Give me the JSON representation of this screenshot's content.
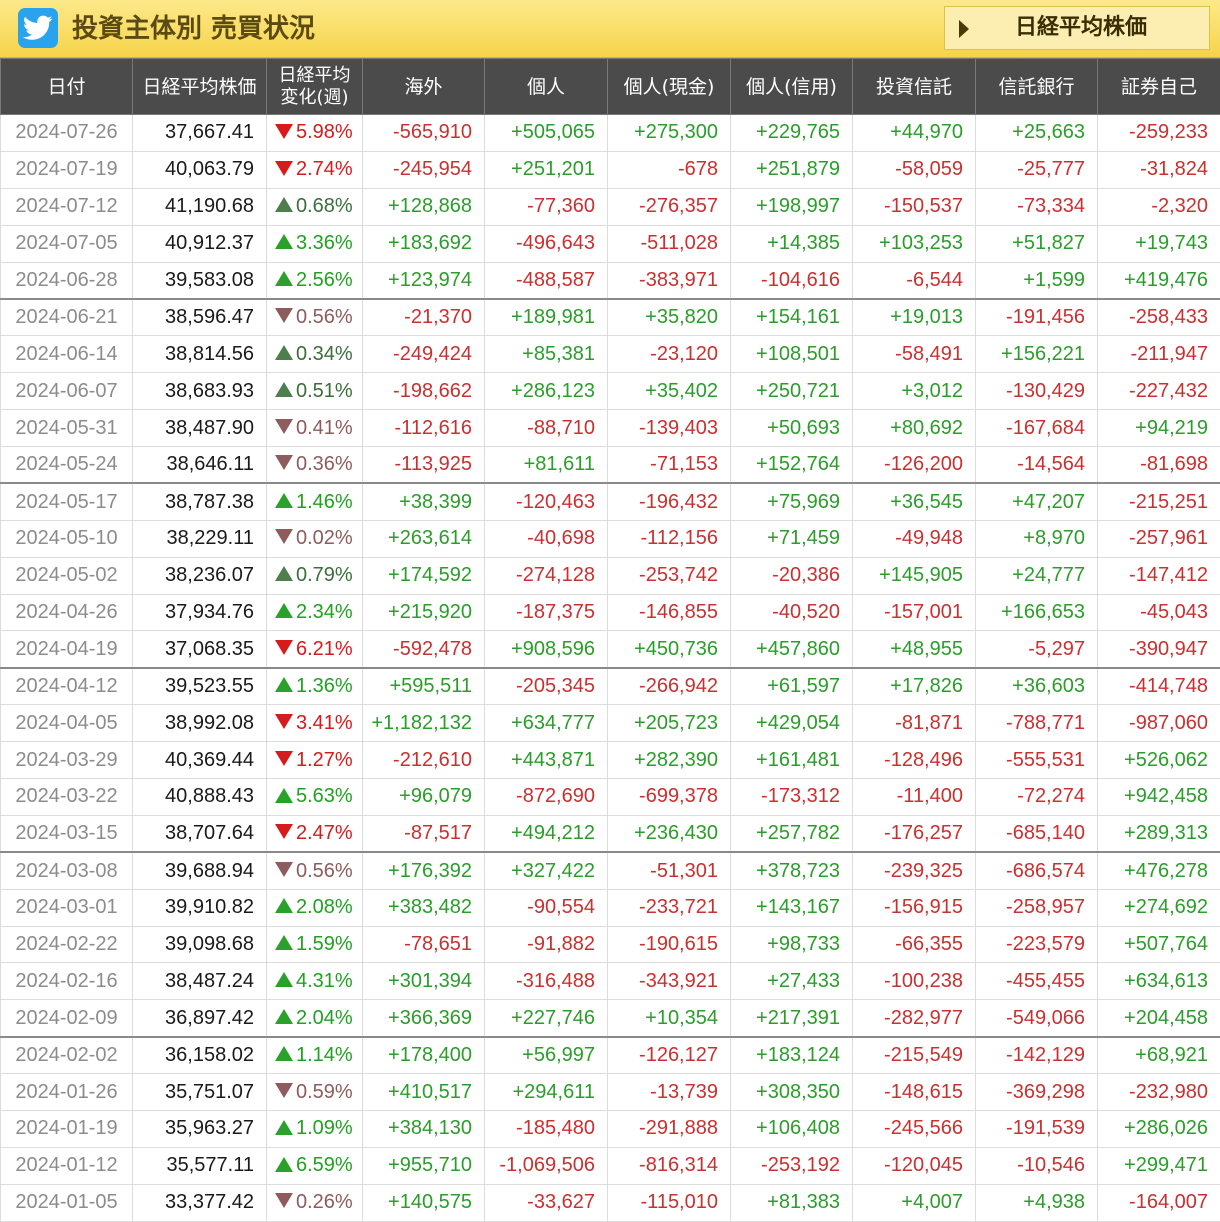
{
  "header": {
    "title": "投資主体別 売買状況",
    "nikkei_button_label": "日経平均株価",
    "twitter_icon": "twitter-bird-icon"
  },
  "colors": {
    "header_bg": "#f6d44a",
    "table_header_bg": "#4b4b4b",
    "positive": "#2a9d2a",
    "negative": "#c93030",
    "twitter": "#2aa3ef"
  },
  "columns": [
    "日付",
    "日経平均株価",
    "日経平均 変化(週)",
    "海外",
    "個人",
    "個人(現金)",
    "個人(信用)",
    "投資信託",
    "信託銀行",
    "証券自己"
  ],
  "rows": [
    {
      "date": "2024-07-26",
      "nikkei": "37,667.41",
      "change": "5.98%",
      "dir": "down",
      "big": true,
      "values": [
        "-565,910",
        "+505,065",
        "+275,300",
        "+229,765",
        "+44,970",
        "+25,663",
        "-259,233"
      ]
    },
    {
      "date": "2024-07-19",
      "nikkei": "40,063.79",
      "change": "2.74%",
      "dir": "down",
      "big": true,
      "values": [
        "-245,954",
        "+251,201",
        "-678",
        "+251,879",
        "-58,059",
        "-25,777",
        "-31,824"
      ]
    },
    {
      "date": "2024-07-12",
      "nikkei": "41,190.68",
      "change": "0.68%",
      "dir": "up",
      "big": false,
      "values": [
        "+128,868",
        "-77,360",
        "-276,357",
        "+198,997",
        "-150,537",
        "-73,334",
        "-2,320"
      ]
    },
    {
      "date": "2024-07-05",
      "nikkei": "40,912.37",
      "change": "3.36%",
      "dir": "up",
      "big": true,
      "values": [
        "+183,692",
        "-496,643",
        "-511,028",
        "+14,385",
        "+103,253",
        "+51,827",
        "+19,743"
      ]
    },
    {
      "date": "2024-06-28",
      "nikkei": "39,583.08",
      "change": "2.56%",
      "dir": "up",
      "big": true,
      "values": [
        "+123,974",
        "-488,587",
        "-383,971",
        "-104,616",
        "-6,544",
        "+1,599",
        "+419,476"
      ]
    },
    {
      "date": "2024-06-21",
      "nikkei": "38,596.47",
      "change": "0.56%",
      "dir": "down",
      "big": false,
      "values": [
        "-21,370",
        "+189,981",
        "+35,820",
        "+154,161",
        "+19,013",
        "-191,456",
        "-258,433"
      ]
    },
    {
      "date": "2024-06-14",
      "nikkei": "38,814.56",
      "change": "0.34%",
      "dir": "up",
      "big": false,
      "values": [
        "-249,424",
        "+85,381",
        "-23,120",
        "+108,501",
        "-58,491",
        "+156,221",
        "-211,947"
      ]
    },
    {
      "date": "2024-06-07",
      "nikkei": "38,683.93",
      "change": "0.51%",
      "dir": "up",
      "big": false,
      "values": [
        "-198,662",
        "+286,123",
        "+35,402",
        "+250,721",
        "+3,012",
        "-130,429",
        "-227,432"
      ]
    },
    {
      "date": "2024-05-31",
      "nikkei": "38,487.90",
      "change": "0.41%",
      "dir": "down",
      "big": false,
      "values": [
        "-112,616",
        "-88,710",
        "-139,403",
        "+50,693",
        "+80,692",
        "-167,684",
        "+94,219"
      ]
    },
    {
      "date": "2024-05-24",
      "nikkei": "38,646.11",
      "change": "0.36%",
      "dir": "down",
      "big": false,
      "values": [
        "-113,925",
        "+81,611",
        "-71,153",
        "+152,764",
        "-126,200",
        "-14,564",
        "-81,698"
      ]
    },
    {
      "date": "2024-05-17",
      "nikkei": "38,787.38",
      "change": "1.46%",
      "dir": "up",
      "big": true,
      "values": [
        "+38,399",
        "-120,463",
        "-196,432",
        "+75,969",
        "+36,545",
        "+47,207",
        "-215,251"
      ]
    },
    {
      "date": "2024-05-10",
      "nikkei": "38,229.11",
      "change": "0.02%",
      "dir": "down",
      "big": false,
      "values": [
        "+263,614",
        "-40,698",
        "-112,156",
        "+71,459",
        "-49,948",
        "+8,970",
        "-257,961"
      ]
    },
    {
      "date": "2024-05-02",
      "nikkei": "38,236.07",
      "change": "0.79%",
      "dir": "up",
      "big": false,
      "values": [
        "+174,592",
        "-274,128",
        "-253,742",
        "-20,386",
        "+145,905",
        "+24,777",
        "-147,412"
      ]
    },
    {
      "date": "2024-04-26",
      "nikkei": "37,934.76",
      "change": "2.34%",
      "dir": "up",
      "big": true,
      "values": [
        "+215,920",
        "-187,375",
        "-146,855",
        "-40,520",
        "-157,001",
        "+166,653",
        "-45,043"
      ]
    },
    {
      "date": "2024-04-19",
      "nikkei": "37,068.35",
      "change": "6.21%",
      "dir": "down",
      "big": true,
      "values": [
        "-592,478",
        "+908,596",
        "+450,736",
        "+457,860",
        "+48,955",
        "-5,297",
        "-390,947"
      ]
    },
    {
      "date": "2024-04-12",
      "nikkei": "39,523.55",
      "change": "1.36%",
      "dir": "up",
      "big": true,
      "values": [
        "+595,511",
        "-205,345",
        "-266,942",
        "+61,597",
        "+17,826",
        "+36,603",
        "-414,748"
      ]
    },
    {
      "date": "2024-04-05",
      "nikkei": "38,992.08",
      "change": "3.41%",
      "dir": "down",
      "big": true,
      "values": [
        "+1,182,132",
        "+634,777",
        "+205,723",
        "+429,054",
        "-81,871",
        "-788,771",
        "-987,060"
      ]
    },
    {
      "date": "2024-03-29",
      "nikkei": "40,369.44",
      "change": "1.27%",
      "dir": "down",
      "big": true,
      "values": [
        "-212,610",
        "+443,871",
        "+282,390",
        "+161,481",
        "-128,496",
        "-555,531",
        "+526,062"
      ]
    },
    {
      "date": "2024-03-22",
      "nikkei": "40,888.43",
      "change": "5.63%",
      "dir": "up",
      "big": true,
      "values": [
        "+96,079",
        "-872,690",
        "-699,378",
        "-173,312",
        "-11,400",
        "-72,274",
        "+942,458"
      ]
    },
    {
      "date": "2024-03-15",
      "nikkei": "38,707.64",
      "change": "2.47%",
      "dir": "down",
      "big": true,
      "values": [
        "-87,517",
        "+494,212",
        "+236,430",
        "+257,782",
        "-176,257",
        "-685,140",
        "+289,313"
      ]
    },
    {
      "date": "2024-03-08",
      "nikkei": "39,688.94",
      "change": "0.56%",
      "dir": "down",
      "big": false,
      "values": [
        "+176,392",
        "+327,422",
        "-51,301",
        "+378,723",
        "-239,325",
        "-686,574",
        "+476,278"
      ]
    },
    {
      "date": "2024-03-01",
      "nikkei": "39,910.82",
      "change": "2.08%",
      "dir": "up",
      "big": true,
      "values": [
        "+383,482",
        "-90,554",
        "-233,721",
        "+143,167",
        "-156,915",
        "-258,957",
        "+274,692"
      ]
    },
    {
      "date": "2024-02-22",
      "nikkei": "39,098.68",
      "change": "1.59%",
      "dir": "up",
      "big": true,
      "values": [
        "-78,651",
        "-91,882",
        "-190,615",
        "+98,733",
        "-66,355",
        "-223,579",
        "+507,764"
      ]
    },
    {
      "date": "2024-02-16",
      "nikkei": "38,487.24",
      "change": "4.31%",
      "dir": "up",
      "big": true,
      "values": [
        "+301,394",
        "-316,488",
        "-343,921",
        "+27,433",
        "-100,238",
        "-455,455",
        "+634,613"
      ]
    },
    {
      "date": "2024-02-09",
      "nikkei": "36,897.42",
      "change": "2.04%",
      "dir": "up",
      "big": true,
      "values": [
        "+366,369",
        "+227,746",
        "+10,354",
        "+217,391",
        "-282,977",
        "-549,066",
        "+204,458"
      ]
    },
    {
      "date": "2024-02-02",
      "nikkei": "36,158.02",
      "change": "1.14%",
      "dir": "up",
      "big": true,
      "values": [
        "+178,400",
        "+56,997",
        "-126,127",
        "+183,124",
        "-215,549",
        "-142,129",
        "+68,921"
      ]
    },
    {
      "date": "2024-01-26",
      "nikkei": "35,751.07",
      "change": "0.59%",
      "dir": "down",
      "big": false,
      "values": [
        "+410,517",
        "+294,611",
        "-13,739",
        "+308,350",
        "-148,615",
        "-369,298",
        "-232,980"
      ]
    },
    {
      "date": "2024-01-19",
      "nikkei": "35,963.27",
      "change": "1.09%",
      "dir": "up",
      "big": true,
      "values": [
        "+384,130",
        "-185,480",
        "-291,888",
        "+106,408",
        "-245,566",
        "-191,539",
        "+286,026"
      ]
    },
    {
      "date": "2024-01-12",
      "nikkei": "35,577.11",
      "change": "6.59%",
      "dir": "up",
      "big": true,
      "values": [
        "+955,710",
        "-1,069,506",
        "-816,314",
        "-253,192",
        "-120,045",
        "-10,546",
        "+299,471"
      ]
    },
    {
      "date": "2024-01-05",
      "nikkei": "33,377.42",
      "change": "0.26%",
      "dir": "down",
      "big": false,
      "values": [
        "+140,575",
        "-33,627",
        "-115,010",
        "+81,383",
        "+4,007",
        "+4,938",
        "-164,007"
      ]
    }
  ]
}
